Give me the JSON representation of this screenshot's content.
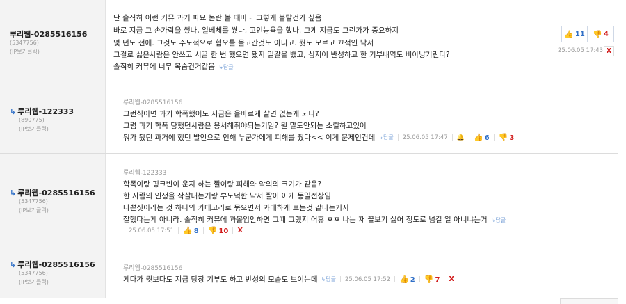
{
  "comments": [
    {
      "author": "루리웹-0285516156",
      "user_id": "(5347756)",
      "ip": "(IP보기클릭)",
      "parent": "",
      "is_reply": false,
      "lines": [
        "난 솔직히 이런 커뮤 과거 파묘 논란 볼 때마다 그렇게 불탈건가 싶음",
        "바로 지금 그 손가락을 썼나, 일베체를 썼나, 고인능욕을 했나. 그게 지금도 그런가가 중요하지",
        "몇 년도 전에. 그것도 주도적으로 혐오를 몰고간것도 아니고. 뭣도 모르고 끄적인 낙서",
        "그걸로 싫은사람은 안쓰고 시끌 한 번 했으면 됐지 일갈을 뱄고, 심지어 반성하고 한 기부내역도 비아냥거린다?",
        "솔직히 커뮤에 너무 목숨건거같음"
      ],
      "reply_link": "↳답글",
      "timestamp": "25.06.05 17:43",
      "upvotes": "11",
      "downvotes": "4",
      "delete": "X"
    },
    {
      "author": "루리웹-122333",
      "user_id": "(890775)",
      "ip": "(IP보기클릭)",
      "parent": "루리웹-0285516156",
      "is_reply": true,
      "lines": [
        "그런식이면 과거 학폭했어도 지금은 올바르게 살면 없는게 되나?",
        "그럼 과거 학폭 당했던사람은 용서해줘야되는거임? 뭔 말도안되는 소릴하고있어",
        "뭐가 됐던 과거에 했던 발언으로 인해 누군가에게 피해를 줬다<< 이게 문제인건데"
      ],
      "reply_link": "↳답글",
      "timestamp": "25.06.05 17:47",
      "upvotes": "6",
      "downvotes": "3",
      "delete": ""
    },
    {
      "author": "루리웹-0285516156",
      "user_id": "(5347756)",
      "ip": "(IP보기클릭)",
      "parent": "루리웹-122333",
      "is_reply": true,
      "lines": [
        "학폭이랑 핑크빈이 운지 하는 짤이랑 피해와 악의의 크기가 같음?",
        "한 사람의 인생을 작살내는거랑 부도덕한 낙서 짤이 어케 동일선상임",
        "나쁜짓이라는 것 하나의 카테고리로 묶으면서 과대하게 보는것 같다는거지",
        "잘했다는게 아니라. 솔직히 커뮤에 과몰입안하면 그때 그랬지 어휴 ㅉㅉ 나는 재 꼴보기 싫어 정도로 넘길 일 아니냐는거"
      ],
      "reply_link": "↳답글",
      "timestamp": "25.06.05 17:51",
      "upvotes": "8",
      "downvotes": "10",
      "delete": "X"
    },
    {
      "author": "루리웹-0285516156",
      "user_id": "(5347756)",
      "ip": "(IP보기클릭)",
      "parent": "루리웹-0285516156",
      "is_reply": true,
      "lines": [
        "게다가 뭣보다도 지금 당장 기부도 하고 반성의 모습도 보이는데"
      ],
      "reply_link": "↳답글",
      "timestamp": "25.06.05 17:52",
      "upvotes": "2",
      "downvotes": "7",
      "delete": "X"
    }
  ],
  "icons": {
    "thumb_up": "thumbs-up-icon",
    "thumb_down": "thumbs-down-icon",
    "reply_arrow": "reply-arrow-icon",
    "report": "report-bell-icon"
  },
  "colors": {
    "upvote": "#2f6fc7",
    "downvote": "#d11c1c",
    "author_bg": "#f3f3f3"
  }
}
